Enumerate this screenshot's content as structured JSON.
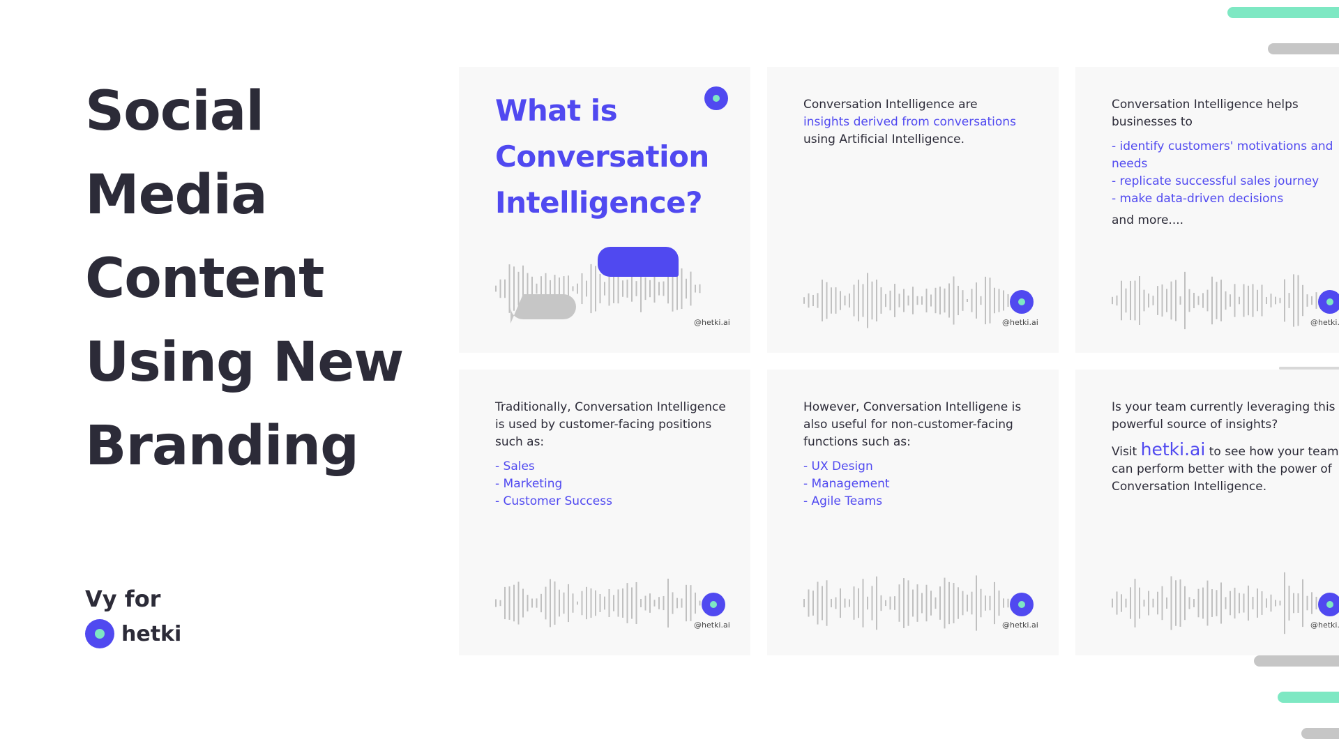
{
  "title": {
    "lines": [
      "Social",
      "Media",
      "Content",
      "Using New",
      "Branding"
    ]
  },
  "byline": {
    "by": "Vy for",
    "brand": "hetki"
  },
  "colors": {
    "accent": "#5049f0",
    "mint": "#7ee8c3",
    "gray_bar": "#c6c6c6",
    "card_bg": "#f8f8f8"
  },
  "handle": "@hetki.ai",
  "handle_cut": "@hetki.",
  "cards": {
    "c1": {
      "question": "What is Conversation Intelligence?"
    },
    "c2": {
      "line1": "Conversation Intelligence are",
      "highlight": "insights derived from conversations",
      "line3": "using Artificial Intelligence."
    },
    "c3": {
      "intro": "Conversation Intelligence helps businesses to",
      "items": [
        "- identify customers' motivations and needs",
        "- replicate successful sales journey",
        "- make data-driven decisions"
      ],
      "outro": "and more...."
    },
    "c4": {
      "intro": "Traditionally, Conversation Intelligence is used by customer-facing positions such as:",
      "items": [
        "- Sales",
        "- Marketing",
        "- Customer Success"
      ]
    },
    "c5": {
      "intro": "However, Conversation Intelligene is also useful for non-customer-facing functions such as:",
      "items": [
        "- UX Design",
        "- Management",
        "- Agile Teams"
      ]
    },
    "c6": {
      "question": "Is your team currently leveraging this powerful source of insights?",
      "visit": "Visit",
      "link": "hetki.ai",
      "rest": "to see how your team can perform better with the power of Conversation Intelligence."
    }
  }
}
